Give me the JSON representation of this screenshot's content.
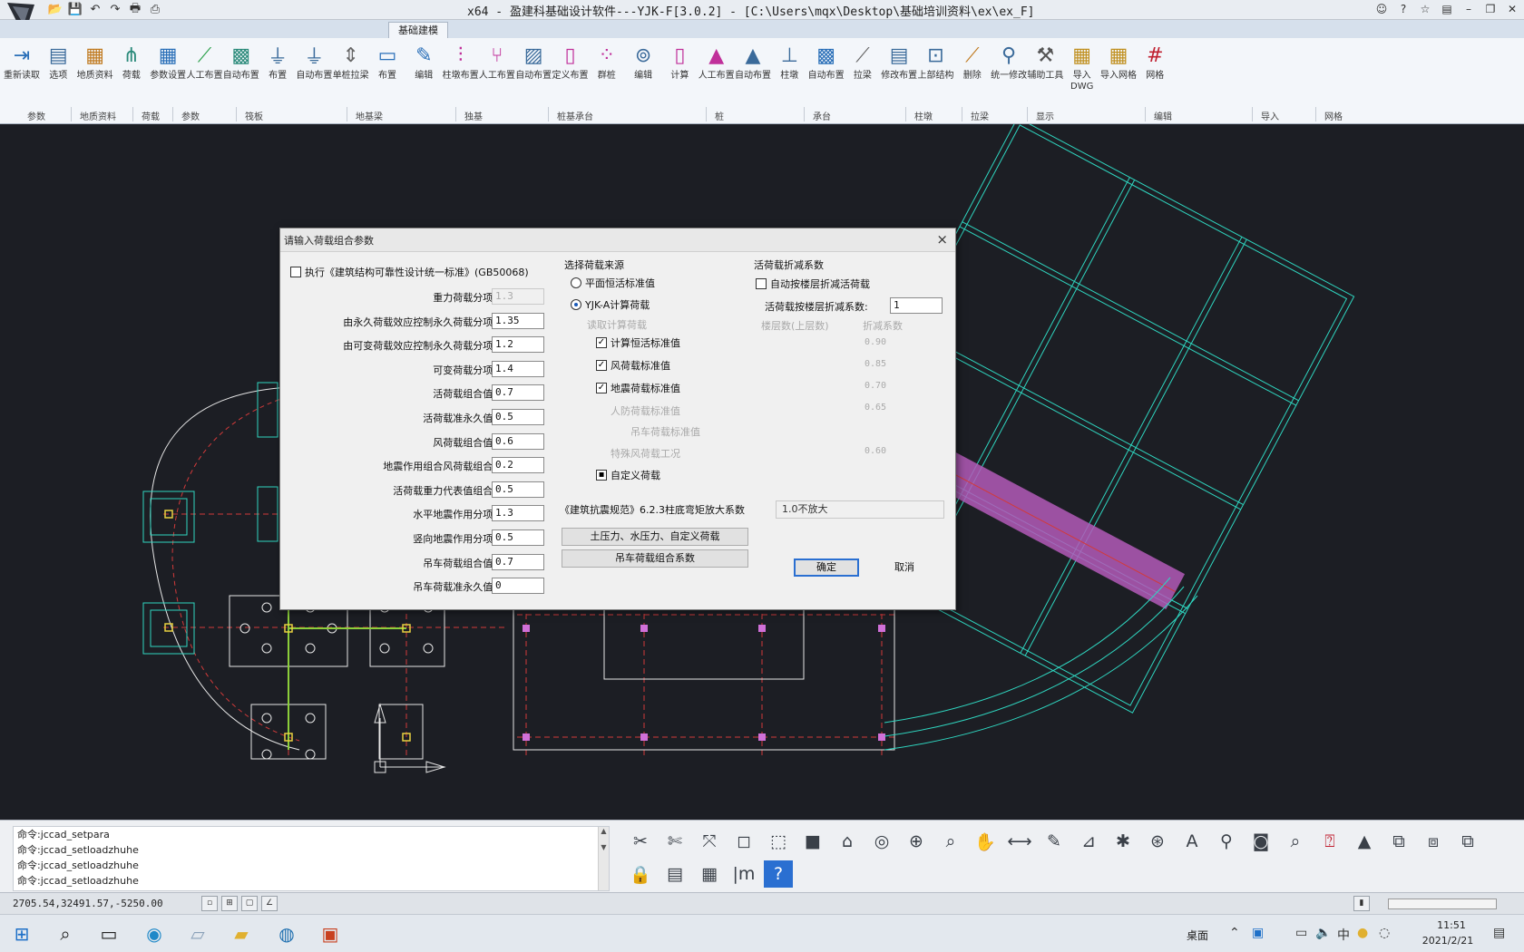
{
  "window": {
    "title": "x64 - 盈建科基础设计软件---YJK-F[3.0.2] - [C:\\Users\\mqx\\Desktop\\基础培训资料\\ex\\ex_F]"
  },
  "ribbon_tabs": [
    {
      "label": "基础建模",
      "active": true
    }
  ],
  "ribbon_buttons": [
    {
      "label": "重新读取",
      "icon": "import-icon"
    },
    {
      "label": "选项",
      "icon": "options-icon"
    },
    {
      "label": "地质资料",
      "icon": "geology-icon"
    },
    {
      "label": "荷载",
      "icon": "load-icon"
    },
    {
      "label": "参数设置",
      "icon": "param-icon"
    },
    {
      "label": "人工布置",
      "icon": "manual-layout-icon"
    },
    {
      "label": "自动布置",
      "icon": "auto-layout-icon"
    },
    {
      "label": "布置",
      "icon": "place-icon"
    },
    {
      "label": "自动布置",
      "icon": "auto-place-icon"
    },
    {
      "label": "单桩拉梁",
      "icon": "pile-beam-icon"
    },
    {
      "label": "布置",
      "icon": "place2-icon"
    },
    {
      "label": "编辑",
      "icon": "edit-icon"
    },
    {
      "label": "柱墩布置",
      "icon": "pier-icon"
    },
    {
      "label": "人工布置",
      "icon": "manual2-icon"
    },
    {
      "label": "自动布置",
      "icon": "auto2-icon"
    },
    {
      "label": "定义布置",
      "icon": "define-icon"
    },
    {
      "label": "群桩",
      "icon": "pile-group-icon"
    },
    {
      "label": "编辑",
      "icon": "edit2-icon"
    },
    {
      "label": "计算",
      "icon": "calc-icon"
    },
    {
      "label": "人工布置",
      "icon": "manual3-icon"
    },
    {
      "label": "自动布置",
      "icon": "auto3-icon"
    },
    {
      "label": "柱墩",
      "icon": "column-icon"
    },
    {
      "label": "自动布置",
      "icon": "auto4-icon"
    },
    {
      "label": "拉梁",
      "icon": "tie-beam-icon"
    },
    {
      "label": "修改布置",
      "icon": "modify-icon"
    },
    {
      "label": "上部结构",
      "icon": "upper-icon"
    },
    {
      "label": "删除",
      "icon": "delete-icon"
    },
    {
      "label": "统一修改",
      "icon": "unify-icon"
    },
    {
      "label": "辅助工具",
      "icon": "tools-icon"
    },
    {
      "label": "导入DWG",
      "icon": "dwg-import-icon"
    },
    {
      "label": "导入网格",
      "icon": "dwg-grid-icon"
    },
    {
      "label": "网格",
      "icon": "grid-icon"
    }
  ],
  "ribbon_groups": [
    "参数",
    "地质资料",
    "荷载",
    "参数",
    "筏板",
    "地基梁",
    "独基",
    "桩基承台",
    "桩",
    "承台",
    "柱墩",
    "拉梁",
    "显示",
    "编辑",
    "导入",
    "网格"
  ],
  "dialog": {
    "title": "请输入荷载组合参数",
    "close": "×",
    "left": {
      "exec_checkbox_label": "执行《建筑结构可靠性设计统一标准》(GB50068)",
      "exec_checked": false,
      "fields": [
        {
          "label": "重力荷载分项系数:",
          "value": "1.3",
          "disabled": true
        },
        {
          "label": "由永久荷载效应控制永久荷载分项系数:",
          "value": "1.35",
          "disabled": false
        },
        {
          "label": "由可变荷载效应控制永久荷载分项系数:",
          "value": "1.2",
          "disabled": false
        },
        {
          "label": "可变荷载分项系数:",
          "value": "1.4",
          "disabled": false
        },
        {
          "label": "活荷载组合值系数:",
          "value": "0.7",
          "disabled": false
        },
        {
          "label": "活荷载准永久值系数:",
          "value": "0.5",
          "disabled": false
        },
        {
          "label": "风荷载组合值系数:",
          "value": "0.6",
          "disabled": false
        },
        {
          "label": "地震作用组合风荷载组合系数:",
          "value": "0.2",
          "disabled": false
        },
        {
          "label": "活荷载重力代表值组合系数:",
          "value": "0.5",
          "disabled": false
        },
        {
          "label": "水平地震作用分项系数:",
          "value": "1.3",
          "disabled": false
        },
        {
          "label": "竖向地震作用分项系数:",
          "value": "0.5",
          "disabled": false
        },
        {
          "label": "吊车荷载组合值系数:",
          "value": "0.7",
          "disabled": false
        },
        {
          "label": "吊车荷载准永久值系数:",
          "value": "0",
          "disabled": false
        }
      ]
    },
    "source": {
      "title": "选择荷载来源",
      "radio1": "平面恒活标准值",
      "radio1_on": false,
      "radio2": "YJK-A计算荷载",
      "radio2_on": true,
      "sub_disabled": "读取计算荷载",
      "cb_dead_live": "计算恒活标准值",
      "cb_wind": "风荷载标准值",
      "cb_seismic": "地震荷载标准值",
      "dis_people": "人防荷载标准值",
      "dis_crane": "吊车荷载标准值",
      "dis_special": "特殊风荷载工况",
      "cb_custom": "自定义荷载",
      "dim_values": [
        "0.90",
        "0.85",
        "0.70",
        "0.65",
        "0.60"
      ]
    },
    "live_reduce": {
      "title": "活荷载折减系数",
      "auto_label": "自动按楼层折减活荷载",
      "auto_checked": false,
      "coef_label": "活荷载按楼层折减系数:",
      "coef_value": "1",
      "dim_label": "楼层数(上层数)",
      "dim_value": "折减系数"
    },
    "amplify_label": "《建筑抗震规范》6.2.3柱底弯矩放大系数",
    "amplify_value": "1.0不放大",
    "btn_earth_water": "土压力、水压力、自定义荷载",
    "btn_crane_combo": "吊车荷载组合系数",
    "btn_ok": "确定",
    "btn_cancel": "取消"
  },
  "command_history": [
    "命令:jccad_setpara",
    "命令:jccad_setloadzhuhe",
    "命令:jccad_setloadzhuhe",
    "命令:jccad_setloadzhuhe"
  ],
  "bottom_tools": [
    "trim-icon",
    "break-icon",
    "extend-icon",
    "box-icon",
    "cube-icon",
    "solid-icon",
    "view3d-icon",
    "orbit-icon",
    "zoom-window-icon",
    "zoom-icon",
    "pan-icon",
    "measure-icon",
    "dimension-icon",
    "angle-icon",
    "node-icon",
    "snap-icon",
    "text-icon",
    "wrench-icon",
    "camera-icon",
    "scale-icon",
    "pdf-icon",
    "export-icon",
    "copy-window-icon",
    "tile-icon",
    "cascade-icon",
    "lock-icon",
    "file-icon",
    "layer-icon",
    "units-icon",
    "help-icon"
  ],
  "status": {
    "coords": "2705.54,32491.57,-5250.00"
  },
  "taskbar": {
    "desktop_label": "桌面",
    "time": "11:51",
    "date": "2021/2/21"
  },
  "colors": {
    "canvas_bg": "#1c1e24",
    "grid_cyan": "#2fd6c0",
    "axis_red": "#d23a3a",
    "beam_magenta": "#d070d8",
    "node_yellow": "#e8d040",
    "white_line": "#e6e6e6"
  }
}
